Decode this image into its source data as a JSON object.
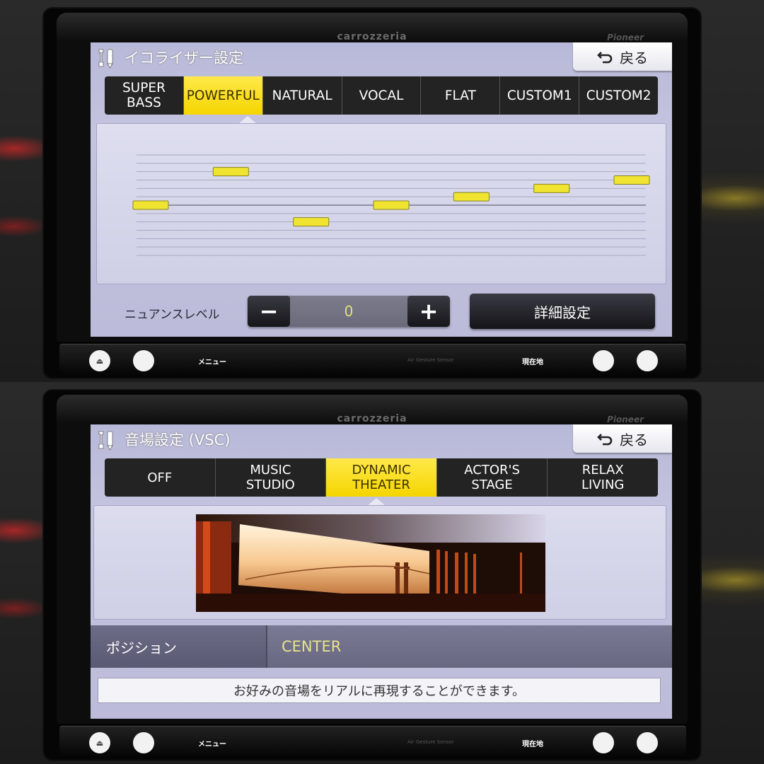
{
  "top_screen": {
    "brand": "carrozzeria",
    "brand2": "Pioneer",
    "title": "イコライザー設定",
    "back_label": "戻る",
    "back_icon": "return-arrow-icon",
    "tabs": [
      {
        "label": "SUPER BASS",
        "active": false
      },
      {
        "label": "POWERFUL",
        "active": true
      },
      {
        "label": "NATURAL",
        "active": false
      },
      {
        "label": "VOCAL",
        "active": false
      },
      {
        "label": "FLAT",
        "active": false
      },
      {
        "label": "CUSTOM1",
        "active": false
      },
      {
        "label": "CUSTOM2",
        "active": false
      }
    ],
    "eq": {
      "levels": 13,
      "band_values": [
        0,
        4,
        -2,
        0,
        1,
        2,
        3
      ],
      "range": [
        -6,
        6
      ]
    },
    "nuance_label": "ニュアンスレベル",
    "nuance_value": "0",
    "minus_label": "−",
    "plus_label": "+",
    "detail_label": "詳細設定"
  },
  "bottom_screen": {
    "brand": "carrozzeria",
    "brand2": "Pioneer",
    "title": "音場設定 (VSC)",
    "back_label": "戻る",
    "tabs": [
      {
        "label": "OFF",
        "active": false
      },
      {
        "label": "MUSIC\nSTUDIO",
        "active": false
      },
      {
        "label": "DYNAMIC\nTHEATER",
        "active": true
      },
      {
        "label": "ACTOR'S\nSTAGE",
        "active": false
      },
      {
        "label": "RELAX\nLIVING",
        "active": false
      }
    ],
    "position_label": "ポジション",
    "position_value": "CENTER",
    "hint": "お好みの音場をリアルに再現することができます。"
  },
  "hardware": {
    "menu_label": "メニュー",
    "current_label": "現在地",
    "sensor_label": "Air Gesture Sensor",
    "eject_icon": "eject-icon"
  },
  "colors": {
    "accent_yellow": "#f5d500",
    "eq_bar": "#f0e430",
    "screen_bg": "#c4c4e0"
  }
}
